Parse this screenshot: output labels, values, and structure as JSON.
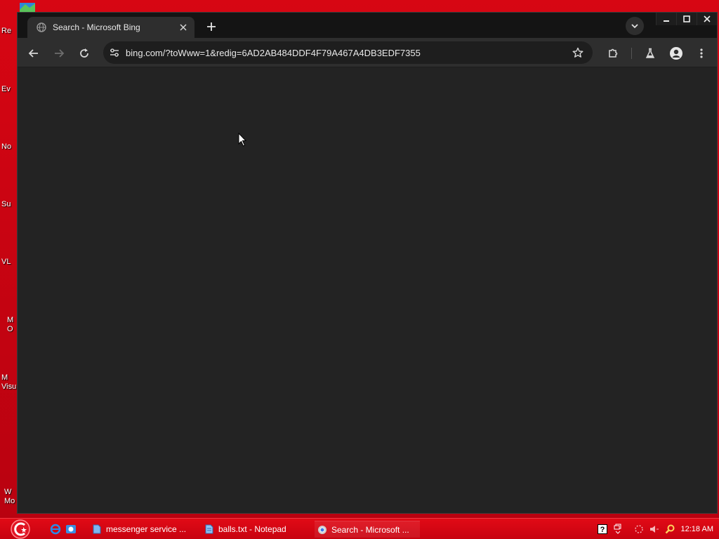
{
  "desktop": {
    "icons": [
      {
        "label": "Re"
      },
      {
        "label": "Ev"
      },
      {
        "label": "No"
      },
      {
        "label": "Su"
      },
      {
        "label": "VL"
      },
      {
        "label": "M\nO"
      },
      {
        "label": "M\nVisu"
      },
      {
        "label": "W\nMo"
      }
    ]
  },
  "browser": {
    "tab": {
      "title": "Search - Microsoft Bing",
      "favicon": "globe-icon"
    },
    "toolbar": {
      "url": "bing.com/?toWww=1&redig=6AD2AB484DDF4F79A467A4DB3EDF7355"
    }
  },
  "taskbar": {
    "tasks": [
      {
        "label": "messenger service ...",
        "icon": "document-icon"
      },
      {
        "label": "balls.txt - Notepad",
        "icon": "notepad-icon"
      },
      {
        "label": "Search - Microsoft ...",
        "icon": "chrome-icon",
        "active": true
      }
    ],
    "clock": "12:18 AM"
  },
  "colors": {
    "desktop": "#c80412",
    "browser_bg": "#232323",
    "titlebar": "#141414",
    "toolbar": "#2e2e2e",
    "omnibox": "#1e1e1e"
  }
}
